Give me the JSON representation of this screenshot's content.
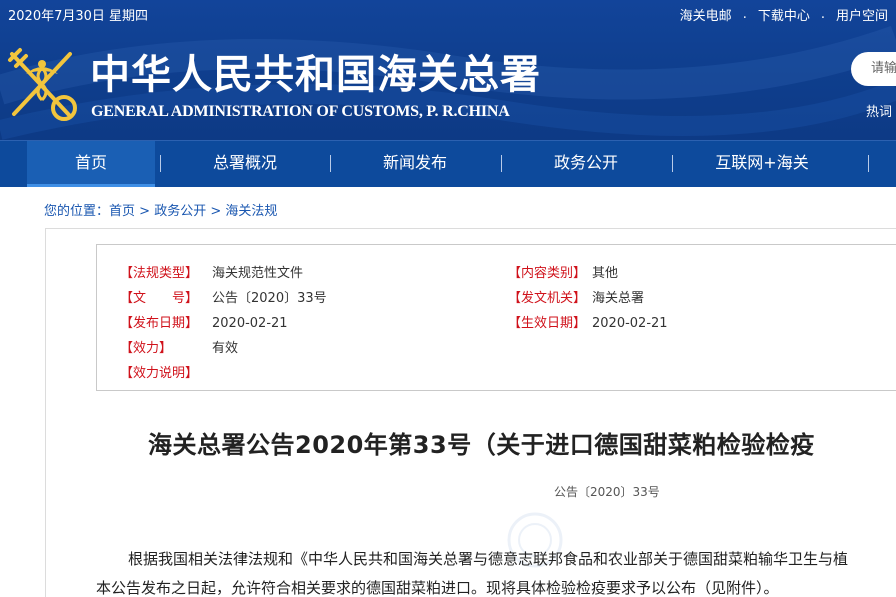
{
  "header": {
    "date": "2020年7月30日 星期四",
    "links": [
      "海关电邮",
      "下载中心",
      "用户空间"
    ],
    "link_separator": ".",
    "title_cn": "中华人民共和国海关总署",
    "title_en": "GENERAL ADMINISTRATION OF CUSTOMS, P. R.CHINA",
    "search_placeholder": "请输入",
    "hot_words_label": "热词",
    "logo": "customs-emblem-icon"
  },
  "nav": {
    "items": [
      "首页",
      "总署概况",
      "新闻发布",
      "政务公开",
      "互联网+海关"
    ],
    "active": "首页",
    "separator": "|"
  },
  "breadcrumb": {
    "prefix": "您的位置：",
    "items": [
      "首页",
      "政务公开",
      "海关法规"
    ],
    "separator": ">"
  },
  "meta": {
    "rows": [
      {
        "label": "【法规类型】",
        "value": "海关规范性文件"
      },
      {
        "label": "【内容类别】",
        "value": "其他"
      },
      {
        "label": "【文　　号】",
        "value": "公告〔2020〕33号"
      },
      {
        "label": "【发文机关】",
        "value": "海关总署"
      },
      {
        "label": "【发布日期】",
        "value": "2020-02-21"
      },
      {
        "label": "【生效日期】",
        "value": "2020-02-21"
      },
      {
        "label": "【效力】",
        "value": "有效"
      },
      {
        "label": "【效力说明】",
        "value": ""
      }
    ]
  },
  "document": {
    "title": "海关总署公告2020年第33号（关于进口德国甜菜粕检验检疫",
    "number": "公告〔2020〕33号",
    "paragraph_line1": "根据我国相关法律法规和《中华人民共和国海关总署与德意志联邦食品和农业部关于德国甜菜粕输华卫生与植",
    "paragraph_line2": "本公告发布之日起，允许符合相关要求的德国甜菜粕进口。现将具体检验检疫要求予以公布（见附件）。"
  },
  "colors": {
    "header_blue": "#12449a",
    "nav_blue": "#0d4a9c",
    "label_red": "#d0121b",
    "link_blue": "#1a57b0"
  }
}
